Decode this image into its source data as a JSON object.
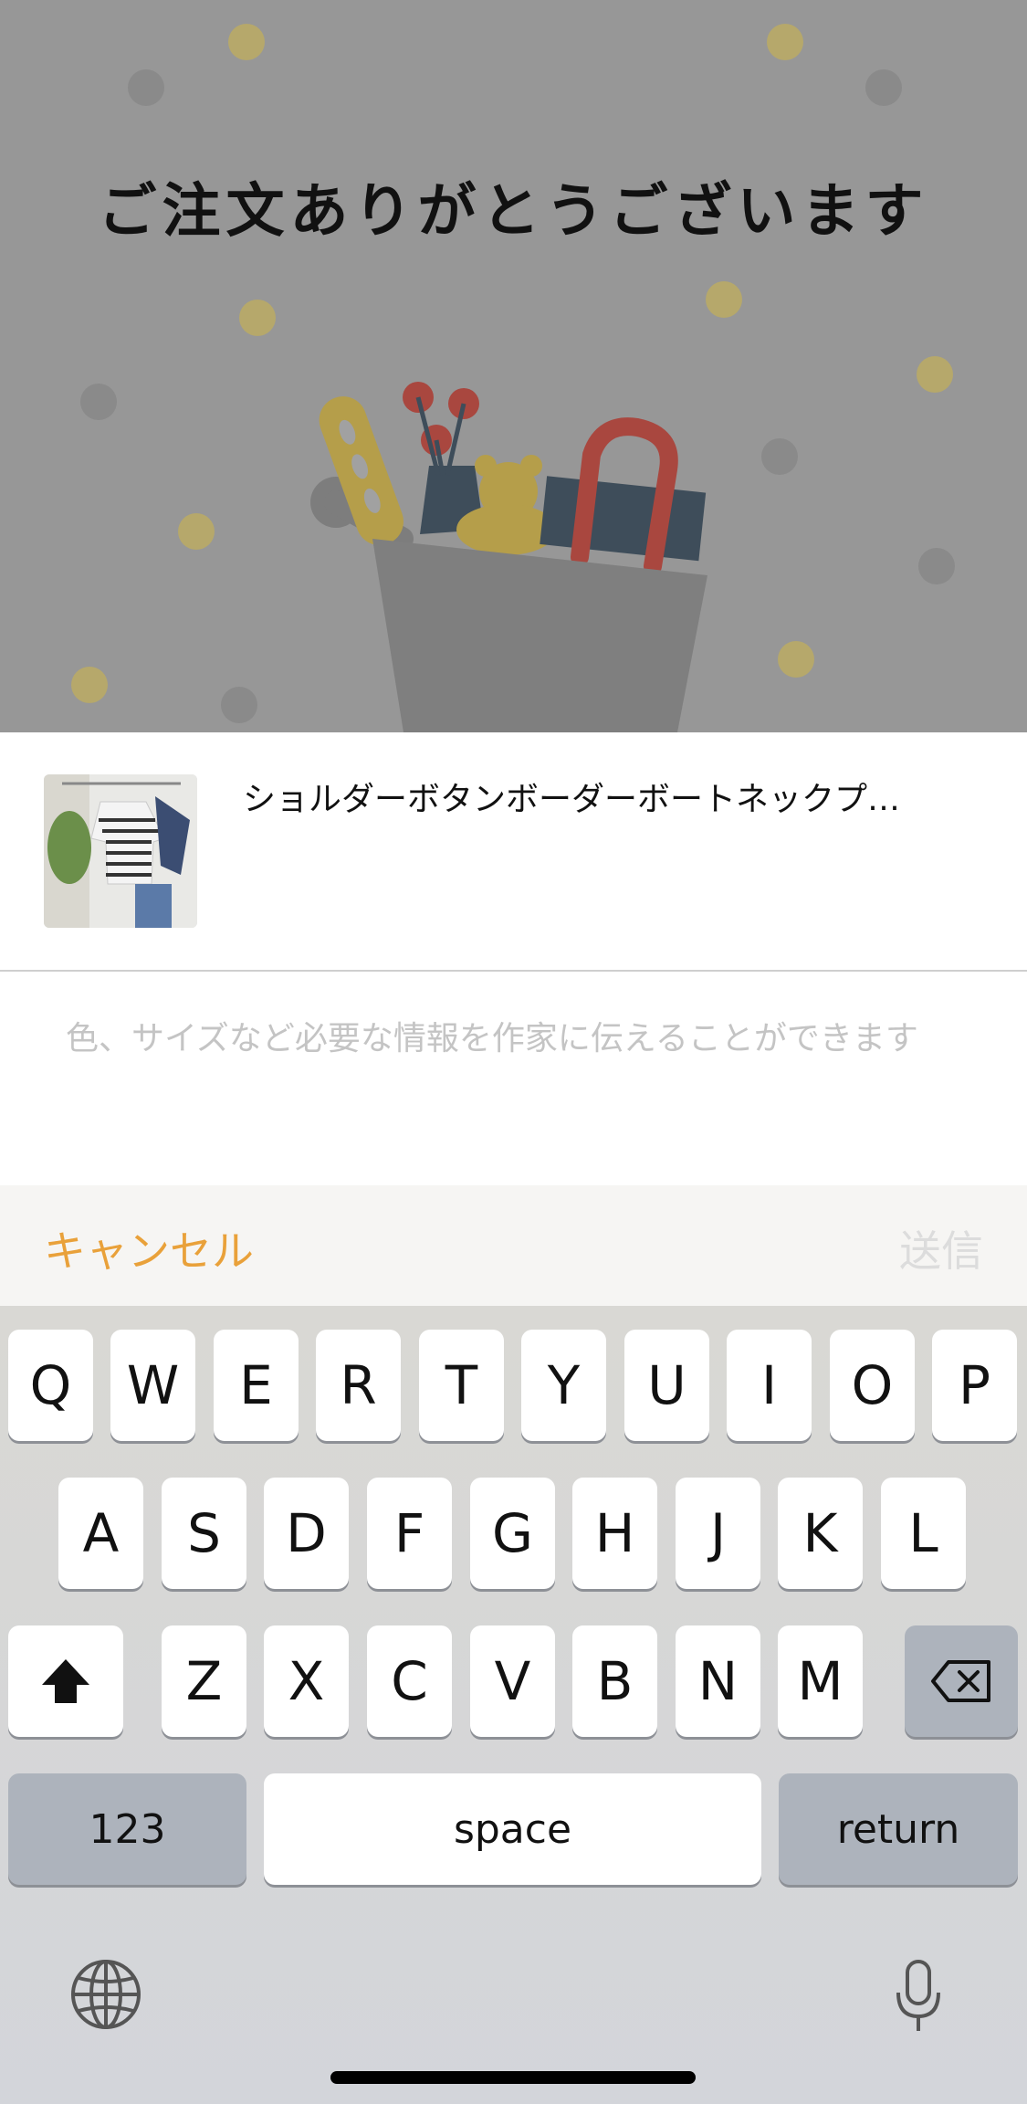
{
  "hero": {
    "title": "ご注文ありがとうございます"
  },
  "product": {
    "title": "ショルダーボタンボーダーボートネックプ…"
  },
  "message": {
    "placeholder": "色、サイズなど必要な情報を作家に伝えることができます"
  },
  "toolbar": {
    "cancel_label": "キャンセル",
    "send_label": "送信"
  },
  "keyboard": {
    "row1": [
      "Q",
      "W",
      "E",
      "R",
      "T",
      "Y",
      "U",
      "I",
      "O",
      "P"
    ],
    "row2": [
      "A",
      "S",
      "D",
      "F",
      "G",
      "H",
      "J",
      "K",
      "L"
    ],
    "row3": [
      "Z",
      "X",
      "C",
      "V",
      "B",
      "N",
      "M"
    ],
    "numbers_label": "123",
    "space_label": "space",
    "return_label": "return",
    "icons": {
      "shift": "shift-icon",
      "delete": "backspace-icon",
      "globe": "globe-icon",
      "mic": "microphone-icon"
    }
  },
  "colors": {
    "accent": "#e9a13a",
    "hero_bg": "#979797",
    "disabled": "#dcdcdc"
  }
}
